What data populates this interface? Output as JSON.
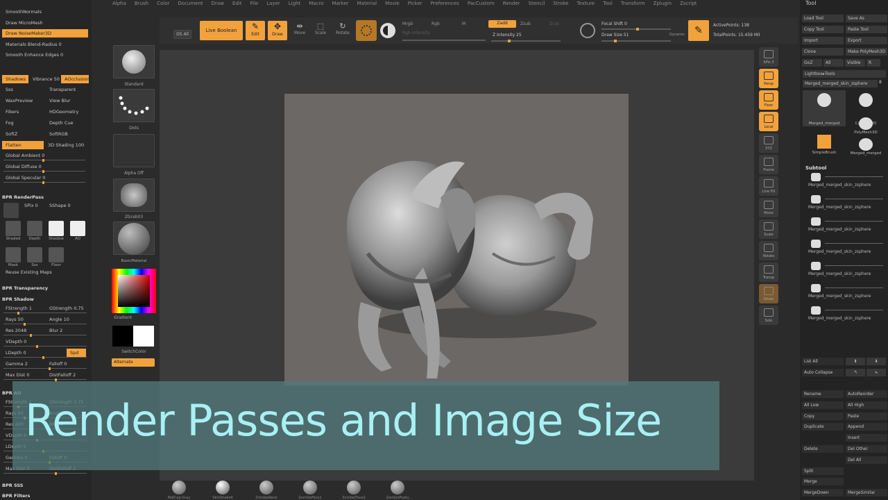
{
  "menu": [
    "Alpha",
    "Brush",
    "Color",
    "Document",
    "Draw",
    "Edit",
    "File",
    "Layer",
    "Light",
    "Macro",
    "Marker",
    "Material",
    "Movie",
    "Picker",
    "Preferences",
    "PacCustom",
    "Render",
    "Stencil",
    "Stroke",
    "Texture",
    "Tool",
    "Transform",
    "Zplugin",
    "Zscript"
  ],
  "top_shelf": {
    "ds_all": "DS All",
    "live_boolean": "Live Boolean",
    "edit": "Edit",
    "draw": "Draw",
    "move": "Move",
    "scale": "Scale",
    "rotate": "Rotate",
    "mrgb": "Mrgb",
    "rgb": "Rgb",
    "m": "M",
    "rgb_intensity": "Rgb Intensity",
    "zadd": "Zadd",
    "zsub": "Zsub",
    "zcut": "Zcut",
    "z_intensity": "Z Intensity 25",
    "focal_shift": "Focal Shift 0",
    "draw_size": "Draw Size 51",
    "dynamic": "Dynamic",
    "active_points": "ActivePoints: 138",
    "total_points": "TotalPoints: 15.459 Mil"
  },
  "left_panel": {
    "rows": [
      {
        "label": "SmoothNormals",
        "style": ""
      },
      {
        "label": "Draw MicroMesh",
        "style": ""
      },
      {
        "label": "Draw NoiseMaker3D",
        "style": "orange"
      },
      {
        "label": "Materials Blend-Radius 0",
        "style": ""
      },
      {
        "label": "Smooth Enhance Edges 0",
        "style": ""
      }
    ],
    "shadows": "Shadows",
    "vibrance": "Vibrance 50",
    "aocclusion": "AOcclusion",
    "options": [
      [
        "Sss",
        "Transparent"
      ],
      [
        "WaxPreview",
        "View Blur"
      ],
      [
        "Fibers",
        "HDGeometry"
      ],
      [
        "Fog",
        "Depth Cue"
      ],
      [
        "SoftZ",
        "SoftRGB"
      ]
    ],
    "flatten": "Flatten",
    "shading_3d": "3D Shading 100",
    "global": [
      "Global Ambient 0",
      "Global Diffuse 0",
      "Global Specular 0"
    ],
    "bpr_renderpass": "BPR RenderPass",
    "spix": "SPix 0",
    "sshaper": "SShape 0",
    "passes": [
      "Shaded",
      "Depth",
      "Shadow",
      "AO",
      "Mask",
      "Sss",
      "Floor"
    ],
    "reuse_maps": "Reuse Existing Maps",
    "bpr_transparency": "BPR Transparency",
    "bpr_shadow": "BPR Shadow",
    "shadow_rows": [
      [
        "FStrength 1",
        "GStrength 0.75"
      ],
      [
        "Rays 50",
        "Angle 10"
      ],
      [
        "Res 2048",
        "Blur 2"
      ],
      [
        "VDepth 0",
        ""
      ],
      [
        "LDepth 0",
        "Spd"
      ],
      [
        "Gamma 2",
        "Falloff 0"
      ],
      [
        "Max Dist 0",
        "DistFalloff 2"
      ]
    ],
    "bpr_ao": "BPR AO",
    "ao_rows": [
      [
        "FStrength 1",
        "GStrength 0.75"
      ],
      [
        "Rays 50",
        "Angle 360"
      ],
      [
        "Res 400",
        "Blur 4"
      ],
      [
        "VDepth 0",
        ""
      ],
      [
        "LDepth 0",
        ""
      ],
      [
        "Gamma 5",
        "Falloff 0"
      ],
      [
        "Max Dist 0",
        "DistFalloff 2"
      ]
    ],
    "bpr_sss": "BPR SSS",
    "bpr_filters": "BPR Filters"
  },
  "brush_column": {
    "items": [
      "Standard",
      "Dots",
      "Alpha Off",
      "ZGrab03",
      "BasicMaterial"
    ],
    "gradient": "Gradient",
    "switch_color": "SwitchColor",
    "alternate": "Alternate"
  },
  "right_column": {
    "items": [
      "SPix 3",
      "Persp",
      "Floor",
      "Local",
      "XYZ",
      "Frame",
      "Line Fill",
      "Move",
      "Scale",
      "Rotate",
      "Transp",
      "Ghost",
      "Solo"
    ]
  },
  "tool_panel": {
    "title": "Tool",
    "buttons": [
      [
        "Load Tool",
        "Save As"
      ],
      [
        "Copy Tool",
        "Paste Tool"
      ],
      [
        "Import",
        "Export"
      ],
      [
        "Clone",
        "Make PolyMesh3D"
      ],
      [
        "GoZ",
        "All",
        "Visible",
        "R"
      ]
    ],
    "lightbox_tools": "Lightbox▸Tools",
    "current_tool": "Merged_merged_skin_zsphere",
    "current_tool_count": "8",
    "thumbs": [
      "Merged_merged",
      "Cylinder3D",
      "PolyMesh3D",
      "SimpleBrush",
      "Merged_merged"
    ],
    "subtool": "Subtool",
    "subtools": [
      "Merged_merged_skin_zsphere",
      "Merged_merged_skin_zsphere",
      "Merged_merged_skin_zsphere",
      "Merged_merged_skin_zsphere",
      "Merged_merged_skin_zsphere",
      "Merged_merged_skin_zsphere",
      "Merged_merged_skin_zsphere"
    ],
    "list_all": "List All",
    "auto_collapse": "Auto Collapse",
    "bottom": [
      [
        "Rename",
        "AutoReorder"
      ],
      [
        "All Low",
        "All High"
      ],
      [
        "Copy",
        "Paste"
      ],
      [
        "Duplicate",
        "Append"
      ],
      [
        "",
        "Insert"
      ],
      [
        "Delete",
        "Del Other"
      ],
      [
        "",
        "Del All"
      ],
      [
        "Split",
        ""
      ],
      [
        "Merge",
        ""
      ],
      [
        "MergeDown",
        "MergeSimilar"
      ]
    ]
  },
  "bottom_shelf": [
    "MatCap Gray",
    "SkinShade4",
    "ZombieNeck",
    "ZombieFace1",
    "ZombieFace2",
    "ZombieFeatu"
  ],
  "banner": {
    "title": "Render Passes and Image Size"
  },
  "colors": {
    "accent": "#f2a23c",
    "banner_text": "#a8f0f4",
    "banner_bg": "#52787a"
  }
}
